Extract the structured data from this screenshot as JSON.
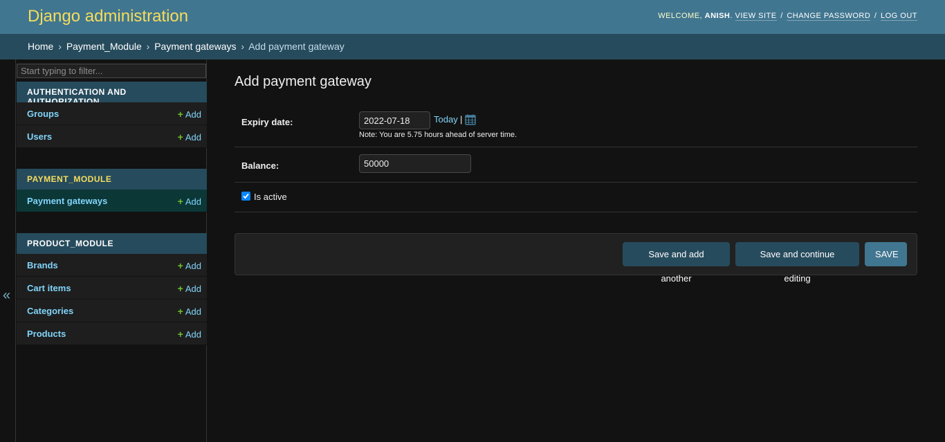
{
  "header": {
    "site_name": "Django administration",
    "welcome_prefix": "Welcome, ",
    "username": "Anish",
    "welcome_suffix": ". ",
    "view_site": "View site",
    "change_password": "Change password",
    "log_out": "Log out",
    "separator": "/"
  },
  "breadcrumbs": {
    "home": "Home",
    "module": "Payment_Module",
    "model": "Payment gateways",
    "current": "Add payment gateway",
    "separator": "›"
  },
  "sidebar": {
    "filter_placeholder": "Start typing to filter...",
    "toggle_symbol": "«",
    "add_label": "Add",
    "modules": [
      {
        "caption": "Authentication and Authorization",
        "models": [
          "Groups",
          "Users"
        ]
      },
      {
        "caption": "Payment_Module",
        "models": [
          "Payment gateways"
        ]
      },
      {
        "caption": "Product_Module",
        "models": [
          "Brands",
          "Cart items",
          "Categories",
          "Products"
        ]
      }
    ]
  },
  "form": {
    "title": "Add payment gateway",
    "expiry_date": {
      "label": "Expiry date:",
      "value": "2022-07-18",
      "today_label": "Today",
      "separator": "|",
      "note": "Note: You are 5.75 hours ahead of server time."
    },
    "balance": {
      "label": "Balance:",
      "value": "50000"
    },
    "is_active": {
      "label": "Is active",
      "checked": true
    }
  },
  "submit": {
    "save_add_another": "Save and add another",
    "save_continue": "Save and continue editing",
    "save": "Save"
  },
  "colors": {
    "header_bg": "#417690",
    "breadcrumb_bg": "#264b5d",
    "site_name": "#f5dd5d",
    "link": "#81d4fa",
    "add_plus": "#70bf2b",
    "current_row": "#0c3737"
  }
}
